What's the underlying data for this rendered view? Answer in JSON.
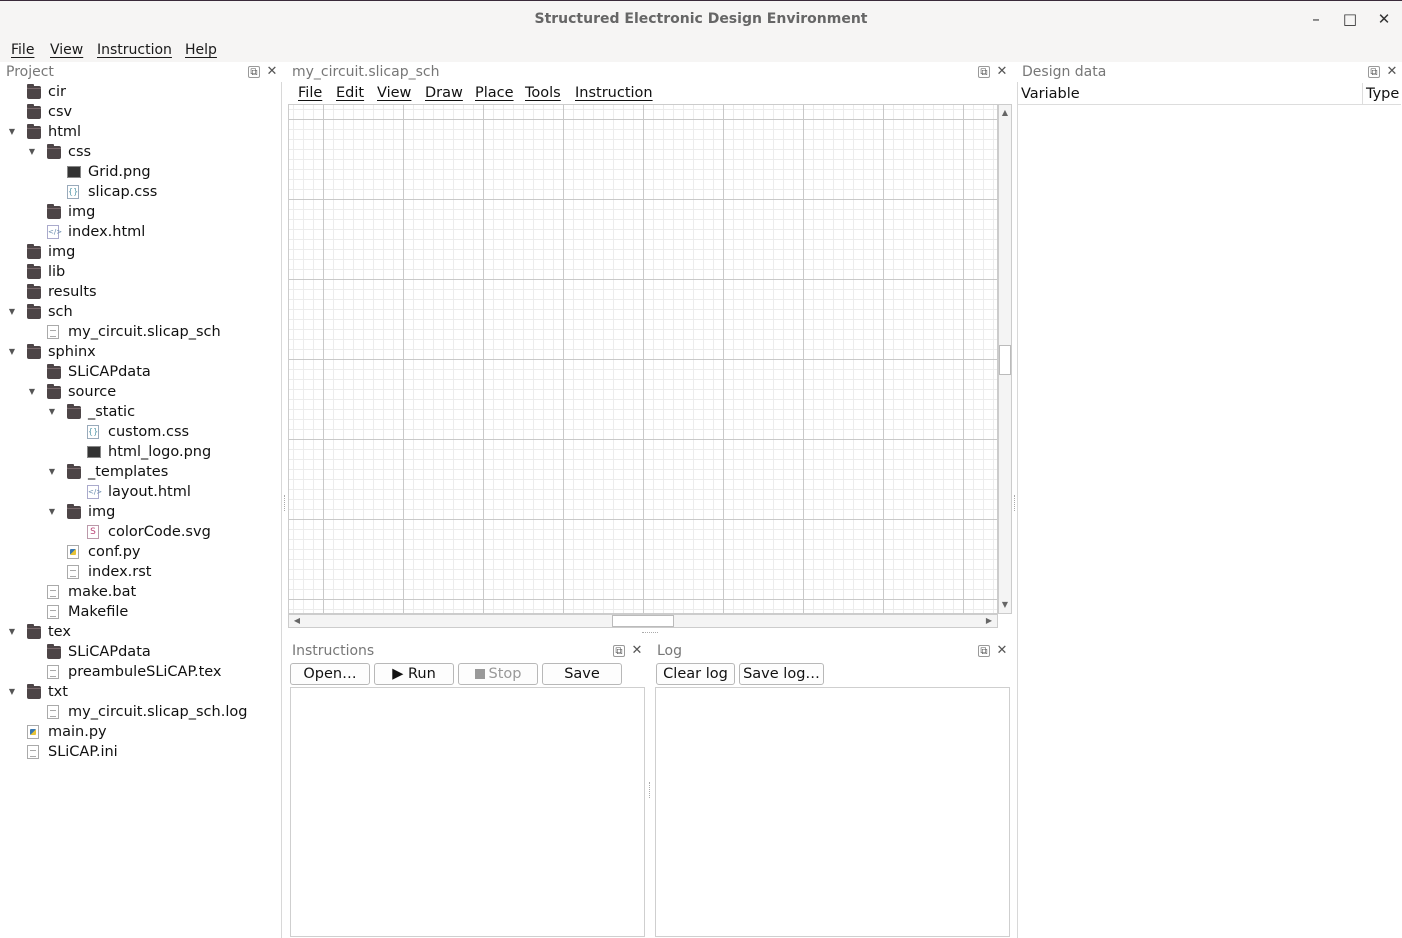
{
  "window": {
    "title": "Structured Electronic Design Environment",
    "controls": [
      "–",
      "□",
      "✕"
    ]
  },
  "menubar": [
    "File",
    "View",
    "Instruction",
    "Help"
  ],
  "project": {
    "title": "Project",
    "tree": [
      {
        "label": "cir",
        "type": "folder",
        "depth": 0,
        "expanded": null
      },
      {
        "label": "csv",
        "type": "folder",
        "depth": 0,
        "expanded": null
      },
      {
        "label": "html",
        "type": "folder",
        "depth": 0,
        "expanded": true
      },
      {
        "label": "css",
        "type": "folder",
        "depth": 1,
        "expanded": true
      },
      {
        "label": "Grid.png",
        "type": "image",
        "depth": 2,
        "expanded": null
      },
      {
        "label": "slicap.css",
        "type": "css",
        "depth": 2,
        "expanded": null
      },
      {
        "label": "img",
        "type": "folder",
        "depth": 1,
        "expanded": null
      },
      {
        "label": "index.html",
        "type": "html",
        "depth": 1,
        "expanded": null
      },
      {
        "label": "img",
        "type": "folder",
        "depth": 0,
        "expanded": null
      },
      {
        "label": "lib",
        "type": "folder",
        "depth": 0,
        "expanded": null
      },
      {
        "label": "results",
        "type": "folder",
        "depth": 0,
        "expanded": null
      },
      {
        "label": "sch",
        "type": "folder",
        "depth": 0,
        "expanded": true
      },
      {
        "label": "my_circuit.slicap_sch",
        "type": "doc",
        "depth": 1,
        "expanded": null
      },
      {
        "label": "sphinx",
        "type": "folder",
        "depth": 0,
        "expanded": true
      },
      {
        "label": "SLiCAPdata",
        "type": "folder",
        "depth": 1,
        "expanded": null
      },
      {
        "label": "source",
        "type": "folder",
        "depth": 1,
        "expanded": true
      },
      {
        "label": "_static",
        "type": "folder",
        "depth": 2,
        "expanded": true
      },
      {
        "label": "custom.css",
        "type": "css",
        "depth": 3,
        "expanded": null
      },
      {
        "label": "html_logo.png",
        "type": "image",
        "depth": 3,
        "expanded": null
      },
      {
        "label": "_templates",
        "type": "folder",
        "depth": 2,
        "expanded": true
      },
      {
        "label": "layout.html",
        "type": "html",
        "depth": 3,
        "expanded": null
      },
      {
        "label": "img",
        "type": "folder",
        "depth": 2,
        "expanded": true
      },
      {
        "label": "colorCode.svg",
        "type": "svg",
        "depth": 3,
        "expanded": null
      },
      {
        "label": "conf.py",
        "type": "py",
        "depth": 2,
        "expanded": null
      },
      {
        "label": "index.rst",
        "type": "doc",
        "depth": 2,
        "expanded": null
      },
      {
        "label": "make.bat",
        "type": "doc",
        "depth": 1,
        "expanded": null
      },
      {
        "label": "Makefile",
        "type": "doc",
        "depth": 1,
        "expanded": null
      },
      {
        "label": "tex",
        "type": "folder",
        "depth": 0,
        "expanded": true
      },
      {
        "label": "SLiCAPdata",
        "type": "folder",
        "depth": 1,
        "expanded": null
      },
      {
        "label": "preambuleSLiCAP.tex",
        "type": "doc",
        "depth": 1,
        "expanded": null
      },
      {
        "label": "txt",
        "type": "folder",
        "depth": 0,
        "expanded": true
      },
      {
        "label": "my_circuit.slicap_sch.log",
        "type": "doc",
        "depth": 1,
        "expanded": null
      },
      {
        "label": "main.py",
        "type": "py",
        "depth": 0,
        "expanded": null
      },
      {
        "label": "SLiCAP.ini",
        "type": "doc",
        "depth": 0,
        "expanded": null
      }
    ]
  },
  "schematic": {
    "title": "my_circuit.slicap_sch",
    "menu": [
      "File",
      "Edit",
      "View",
      "Draw",
      "Place",
      "Tools",
      "Instruction"
    ]
  },
  "instructions": {
    "title": "Instructions",
    "open_label": "Open…",
    "run_label": "▶ Run",
    "stop_label": "Stop",
    "save_label": "Save"
  },
  "log": {
    "title": "Log",
    "clear_label": "Clear log",
    "save_label": "Save log…"
  },
  "design_data": {
    "title": "Design data",
    "columns": [
      "Variable",
      "Type"
    ]
  }
}
